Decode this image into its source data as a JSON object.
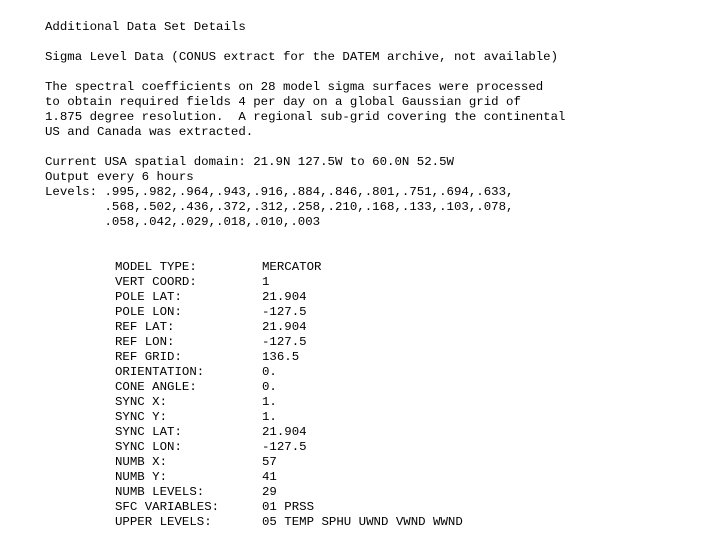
{
  "document": {
    "title": "Additional Data Set Details",
    "subtitle": "Sigma Level Data (CONUS extract for the DATEM archive, not available)",
    "description_lines": [
      "The spectral coefficients on 28 model sigma surfaces were processed",
      "to obtain required fields 4 per day on a global Gaussian grid of",
      "1.875 degree resolution.  A regional sub-grid covering the continental",
      "US and Canada was extracted."
    ],
    "domain_lines": [
      "Current USA spatial domain: 21.9N 127.5W to 60.0N 52.5W",
      "Output every 6 hours",
      "Levels: .995,.982,.964,.943,.916,.884,.846,.801,.751,.694,.633,",
      "        .568,.502,.436,.372,.312,.258,.210,.168,.133,.103,.078,",
      "        .058,.042,.029,.018,.010,.003"
    ],
    "parameters": [
      {
        "label": "MODEL TYPE:",
        "value": "MERCATOR"
      },
      {
        "label": "VERT COORD:",
        "value": "1"
      },
      {
        "label": "POLE LAT:",
        "value": "21.904"
      },
      {
        "label": "POLE LON:",
        "value": "-127.5"
      },
      {
        "label": "REF LAT:",
        "value": "21.904"
      },
      {
        "label": "REF LON:",
        "value": "-127.5"
      },
      {
        "label": "REF GRID:",
        "value": "136.5"
      },
      {
        "label": "ORIENTATION:",
        "value": "0."
      },
      {
        "label": "CONE ANGLE:",
        "value": "0."
      },
      {
        "label": "SYNC X:",
        "value": "1."
      },
      {
        "label": "SYNC Y:",
        "value": "1."
      },
      {
        "label": "SYNC LAT:",
        "value": "21.904"
      },
      {
        "label": "SYNC LON:",
        "value": "-127.5"
      },
      {
        "label": "NUMB X:",
        "value": "57"
      },
      {
        "label": "NUMB Y:",
        "value": "41"
      },
      {
        "label": "NUMB LEVELS:",
        "value": "29"
      },
      {
        "label": "SFC VARIABLES:",
        "value": "01 PRSS"
      },
      {
        "label": "UPPER LEVELS:",
        "value": "05 TEMP SPHU UWND VWND WWND"
      }
    ]
  },
  "colors": {
    "background": "#ffffff",
    "text": "#000000"
  }
}
